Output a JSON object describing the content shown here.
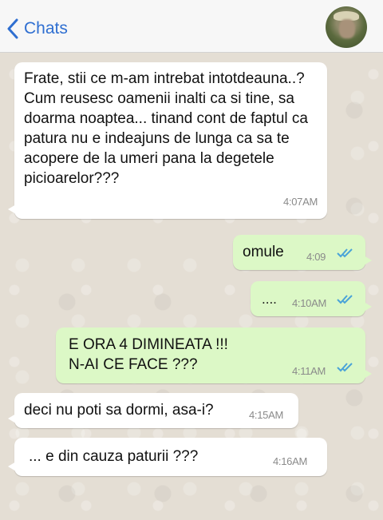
{
  "header": {
    "back_label": "Chats",
    "accent_color": "#2f6fd1",
    "back_icon": "chevron-left-icon",
    "avatar": "contact-avatar-photo"
  },
  "messages": [
    {
      "direction": "incoming",
      "text": "Frate, stii ce m-am intrebat intotdeauna..? Cum reusesc oamenii inalti ca si tine, sa doarma noaptea... tinand cont de faptul ca patura nu e indeajuns de lunga ca sa te acopere de la umeri pana la degetele picioarelor???",
      "time": "4:07AM"
    },
    {
      "direction": "outgoing",
      "text": "omule",
      "time": "4:09",
      "status_icon": "double-check-icon"
    },
    {
      "direction": "outgoing",
      "text": "....",
      "time": "4:10AM",
      "status_icon": "double-check-icon"
    },
    {
      "direction": "outgoing",
      "text_lines": [
        "E ORA 4 DIMINEATA !!!",
        "N-AI CE FACE ???"
      ],
      "time": "4:11AM",
      "status_icon": "double-check-icon"
    },
    {
      "direction": "incoming",
      "text": "deci nu poti sa dormi, asa-i?",
      "time": "4:15AM"
    },
    {
      "direction": "incoming",
      "text": "... e din cauza paturii ???",
      "time": "4:16AM"
    }
  ],
  "colors": {
    "incoming_bubble": "#ffffff",
    "outgoing_bubble": "#dcf8c6",
    "read_ticks": "#4aa3d8"
  }
}
